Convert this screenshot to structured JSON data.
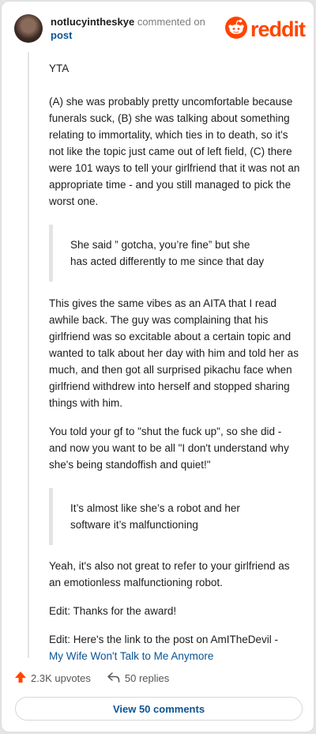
{
  "header": {
    "username": "notlucyintheskye",
    "action_text": "commented on",
    "post_link": "post",
    "logo_text": "reddit"
  },
  "comment": {
    "p1": "YTA",
    "p2": "(A) she was probably pretty uncomfortable because funerals suck, (B) she was talking about something relating to immortality, which ties in to death, so it's not like the topic just came out of left field, (C) there were 101 ways to tell your girlfriend that it was not an appropriate time - and you still managed to pick the worst one.",
    "quote1": "She said ” gotcha, you’re fine” but she has acted differently to me since that day",
    "p3": "This gives the same vibes as an AITA that I read awhile back. The guy was complaining that his girlfriend was so excitable about a certain topic and wanted to talk about her day with him and told her as much, and then got all surprised pikachu face when girlfriend withdrew into herself and stopped sharing things with him.",
    "p4": "You told your gf to \"shut the fuck up\", so she did - and now you want to be all \"I don't understand why she's being standoffish and quiet!\"",
    "quote2": "It’s almost like she’s a robot and her software it’s malfunctioning",
    "p5": "Yeah, it's also not great to refer to your girlfriend as an emotionless malfunctioning robot.",
    "p6": "Edit: Thanks for the award!",
    "p7_prefix": "Edit: Here's the link to the post on AmITheDevil -",
    "p7_link": "My Wife Won't Talk to Me Anymore"
  },
  "actions": {
    "upvotes": "2.3K upvotes",
    "replies": "50 replies"
  },
  "footer": {
    "view_comments": "View 50 comments"
  },
  "colors": {
    "accent": "#ff4500",
    "link": "#0b5394"
  },
  "icons": [
    "reddit-logo-icon",
    "upvote-arrow-icon",
    "reply-arrow-icon"
  ]
}
